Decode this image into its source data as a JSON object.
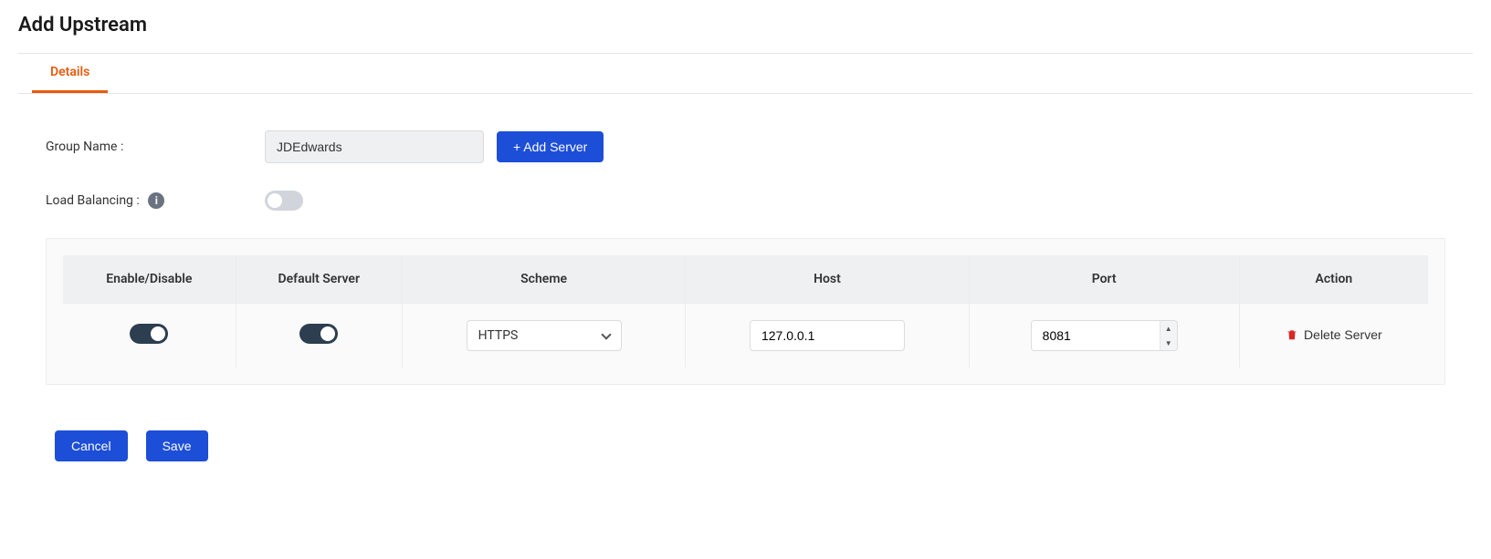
{
  "title": "Add Upstream",
  "tabs": {
    "details": "Details"
  },
  "form": {
    "group_name_label": "Group Name :",
    "group_name_value": "JDEdwards",
    "add_server_label": "+ Add Server",
    "load_balancing_label": "Load Balancing :"
  },
  "table": {
    "headers": {
      "enable": "Enable/Disable",
      "default": "Default Server",
      "scheme": "Scheme",
      "host": "Host",
      "port": "Port",
      "action": "Action"
    },
    "rows": [
      {
        "enable": true,
        "default": true,
        "scheme": "HTTPS",
        "host": "127.0.0.1",
        "port": "8081",
        "delete_label": "Delete Server"
      }
    ]
  },
  "buttons": {
    "cancel": "Cancel",
    "save": "Save"
  }
}
